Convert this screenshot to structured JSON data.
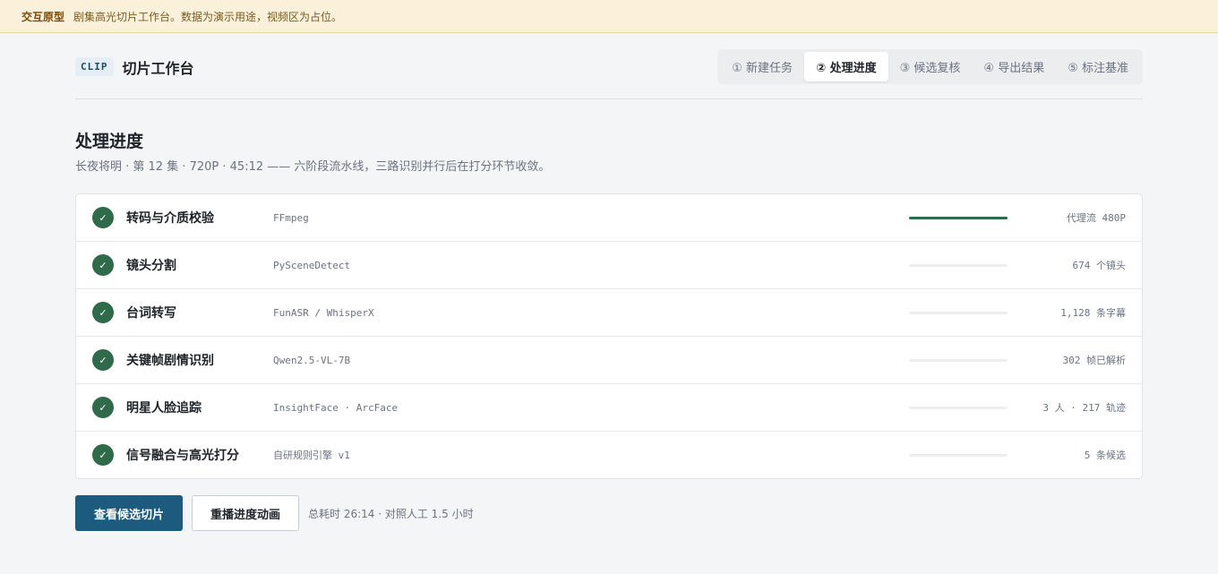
{
  "banner": {
    "tag": "交互原型",
    "message": "剧集高光切片工作台。数据为演示用途，视频区为占位。"
  },
  "header": {
    "badge": "CLIP",
    "title": "切片工作台",
    "steps": [
      {
        "label": "① 新建任务",
        "active": false
      },
      {
        "label": "② 处理进度",
        "active": true
      },
      {
        "label": "③ 候选复核",
        "active": false
      },
      {
        "label": "④ 导出结果",
        "active": false
      },
      {
        "label": "⑤ 标注基准",
        "active": false
      }
    ]
  },
  "page": {
    "title": "处理进度",
    "subtitle": "长夜将明 · 第 12 集 · 720P · 45:12 —— 六阶段流水线，三路识别并行后在打分环节收敛。"
  },
  "stages": [
    {
      "name": "转码与介质校验",
      "tool": "FFmpeg",
      "result": "代理流 480P",
      "progress": 1.0,
      "done": true
    },
    {
      "name": "镜头分割",
      "tool": "PySceneDetect",
      "result": "674 个镜头",
      "progress": 0,
      "done": true
    },
    {
      "name": "台词转写",
      "tool": "FunASR / WhisperX",
      "result": "1,128 条字幕",
      "progress": 0,
      "done": true
    },
    {
      "name": "关键帧剧情识别",
      "tool": "Qwen2.5-VL-7B",
      "result": "302 帧已解析",
      "progress": 0,
      "done": true
    },
    {
      "name": "明星人脸追踪",
      "tool": "InsightFace · ArcFace",
      "result": "3 人 · 217 轨迹",
      "progress": 0,
      "done": true
    },
    {
      "name": "信号融合与高光打分",
      "tool": "自研规则引擎 v1",
      "result": "5 条候选",
      "progress": 0,
      "done": true
    }
  ],
  "actions": {
    "primary": "查看候选切片",
    "secondary": "重播进度动画",
    "meta": "总耗时 26:14 · 对照人工 1.5 小时"
  },
  "colors": {
    "accent": "#1d5b7e",
    "success": "#2f6a4a",
    "banner_bg": "#fbf1da"
  },
  "icons": {
    "stage_done": "check-icon"
  }
}
